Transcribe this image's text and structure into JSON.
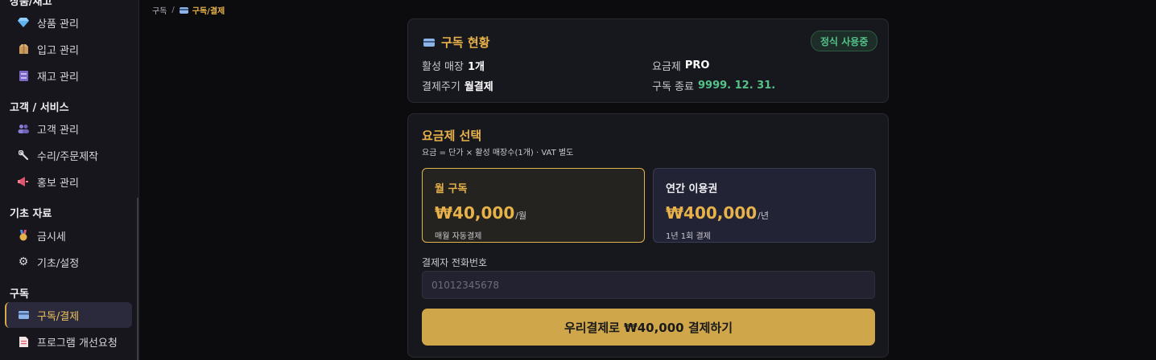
{
  "sidebar": {
    "groups": [
      {
        "title": "상품/재고",
        "items": [
          {
            "label": "상품 관리",
            "icon": "gem-icon"
          },
          {
            "label": "입고 관리",
            "icon": "package-icon"
          },
          {
            "label": "재고 관리",
            "icon": "archive-icon"
          }
        ]
      },
      {
        "title": "고객 / 서비스",
        "items": [
          {
            "label": "고객 관리",
            "icon": "users-icon"
          },
          {
            "label": "수리/주문제작",
            "icon": "wrench-icon"
          },
          {
            "label": "홍보 관리",
            "icon": "megaphone-icon"
          }
        ]
      },
      {
        "title": "기초 자료",
        "items": [
          {
            "label": "금시세",
            "icon": "medal-icon"
          },
          {
            "label": "기초/설정",
            "icon": "gear-icon"
          }
        ]
      },
      {
        "title": "구독",
        "items": [
          {
            "label": "구독/결제",
            "icon": "credit-card-icon",
            "active": true
          },
          {
            "label": "프로그램 개선요청",
            "icon": "document-icon"
          }
        ]
      }
    ]
  },
  "breadcrumb": {
    "root": "구독",
    "separator": "/",
    "current": "구독/결제"
  },
  "status": {
    "title": "구독 현황",
    "badge": "정식 사용중",
    "active_stores_label": "활성 매장",
    "active_stores_value": "1개",
    "plan_label": "요금제",
    "plan_value": "PRO",
    "cycle_label": "결제주기",
    "cycle_value": "월결제",
    "end_label": "구독 종료",
    "end_value": "9999. 12. 31."
  },
  "plan": {
    "title": "요금제 선택",
    "subtitle": "요금 = 단가 × 활성 매장수(1개) · VAT 별도",
    "options": [
      {
        "name": "월 구독",
        "price": "₩40,000",
        "unit": "/월",
        "desc": "매월 자동결제",
        "selected": true
      },
      {
        "name": "연간 이용권",
        "price": "₩400,000",
        "unit": "/년",
        "desc": "1년 1회 결제",
        "selected": false
      }
    ],
    "phone_label": "결제자 전화번호",
    "phone_placeholder": "01012345678",
    "phone_value": "",
    "pay_button": "우리결제로 ₩40,000 결제하기"
  },
  "colors": {
    "accent": "#e8b24a",
    "success": "#55c28a",
    "background": "#0c0c0f",
    "card": "#17171e",
    "button": "#cfa74a"
  }
}
